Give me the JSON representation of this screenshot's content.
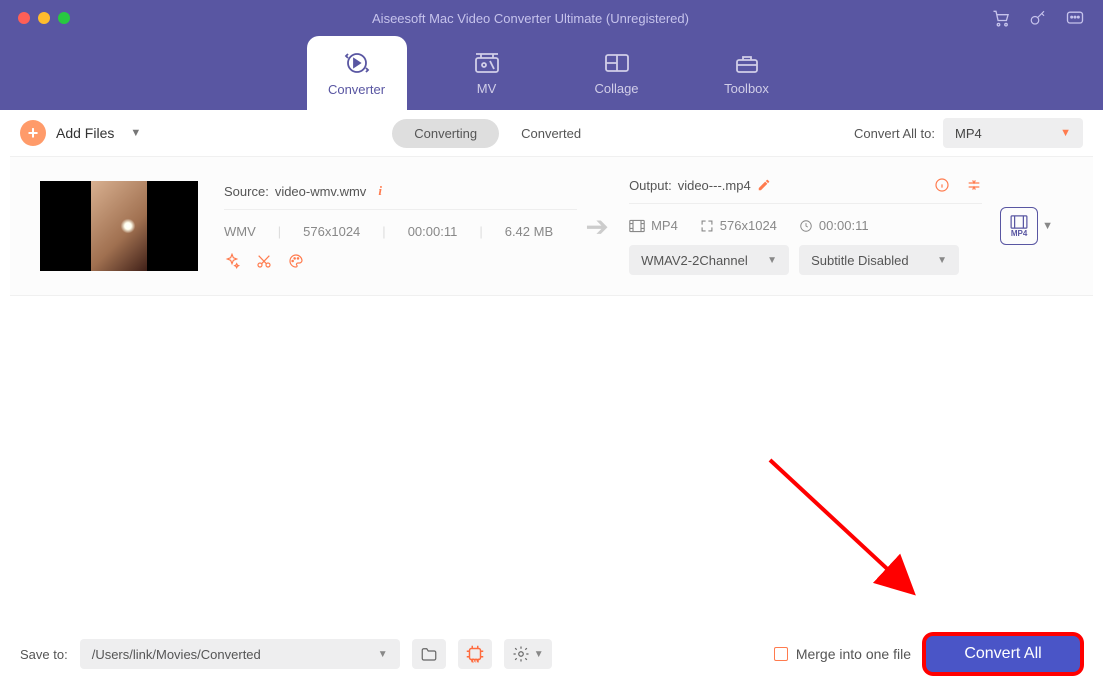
{
  "title": "Aiseesoft Mac Video Converter Ultimate (Unregistered)",
  "nav": {
    "converter": "Converter",
    "mv": "MV",
    "collage": "Collage",
    "toolbox": "Toolbox"
  },
  "toolbar": {
    "add_files": "Add Files",
    "subtab_converting": "Converting",
    "subtab_converted": "Converted",
    "convert_all_label": "Convert All to:",
    "convert_all_value": "MP4"
  },
  "file": {
    "source_label": "Source:",
    "source_name": "video-wmv.wmv",
    "source_format": "WMV",
    "source_res": "576x1024",
    "source_dur": "00:00:11",
    "source_size": "6.42 MB",
    "output_label": "Output:",
    "output_name": "video---.mp4",
    "output_format": "MP4",
    "output_res": "576x1024",
    "output_dur": "00:00:11",
    "audio_select": "WMAV2-2Channel",
    "subtitle_select": "Subtitle Disabled",
    "out_badge": "MP4"
  },
  "bottom": {
    "saveto_label": "Save to:",
    "saveto_path": "/Users/link/Movies/Converted",
    "merge_label": "Merge into one file",
    "convert_all_btn": "Convert All"
  }
}
